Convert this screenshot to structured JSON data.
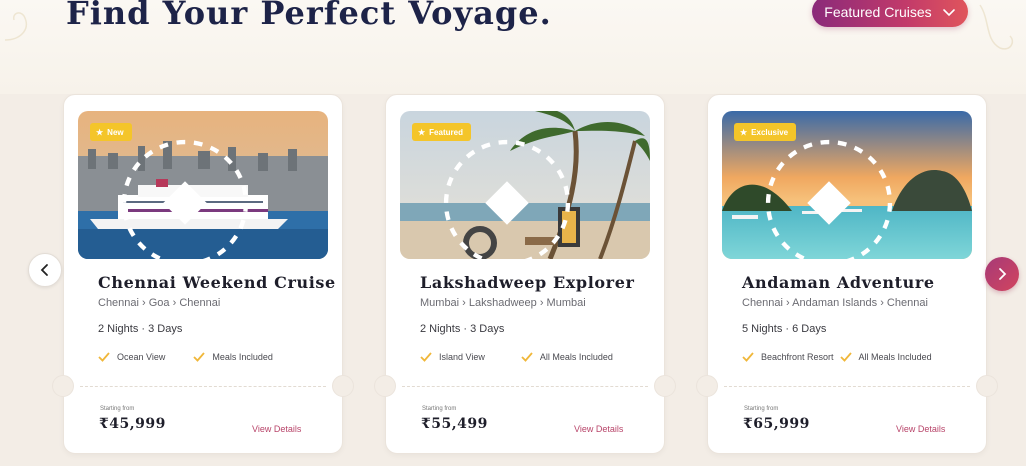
{
  "header": {
    "title": "Find Your Perfect Voyage.",
    "filter_label": "Featured Cruises"
  },
  "colors": {
    "accent_start": "#8a2a7a",
    "accent_end": "#e0555c",
    "badge": "#f4c52a",
    "link": "#b8456a",
    "title_navy": "#1d2348"
  },
  "carousel": {
    "prev_icon": "chevron-left-icon",
    "next_icon": "chevron-right-icon"
  },
  "cards": [
    {
      "badge": "New",
      "title": "Chennai Weekend Cruise",
      "route": "Chennai › Goa › Chennai",
      "duration": "2 Nights · 3 Days",
      "features": [
        "Ocean View",
        "Meals Included"
      ],
      "price_label": "Starting from",
      "price": "₹45,999",
      "cta": "View Details"
    },
    {
      "badge": "Featured",
      "title": "Lakshadweep Explorer",
      "route": "Mumbai › Lakshadweep › Mumbai",
      "duration": "2 Nights · 3 Days",
      "features": [
        "Island View",
        "All Meals Included"
      ],
      "price_label": "Starting from",
      "price": "₹55,499",
      "cta": "View Details"
    },
    {
      "badge": "Exclusive",
      "title": "Andaman Adventure",
      "route": "Chennai › Andaman Islands › Chennai",
      "duration": "5 Nights · 6 Days",
      "features": [
        "Beachfront Resort",
        "All Meals Included"
      ],
      "price_label": "Starting from",
      "price": "₹65,999",
      "cta": "View Details"
    }
  ]
}
